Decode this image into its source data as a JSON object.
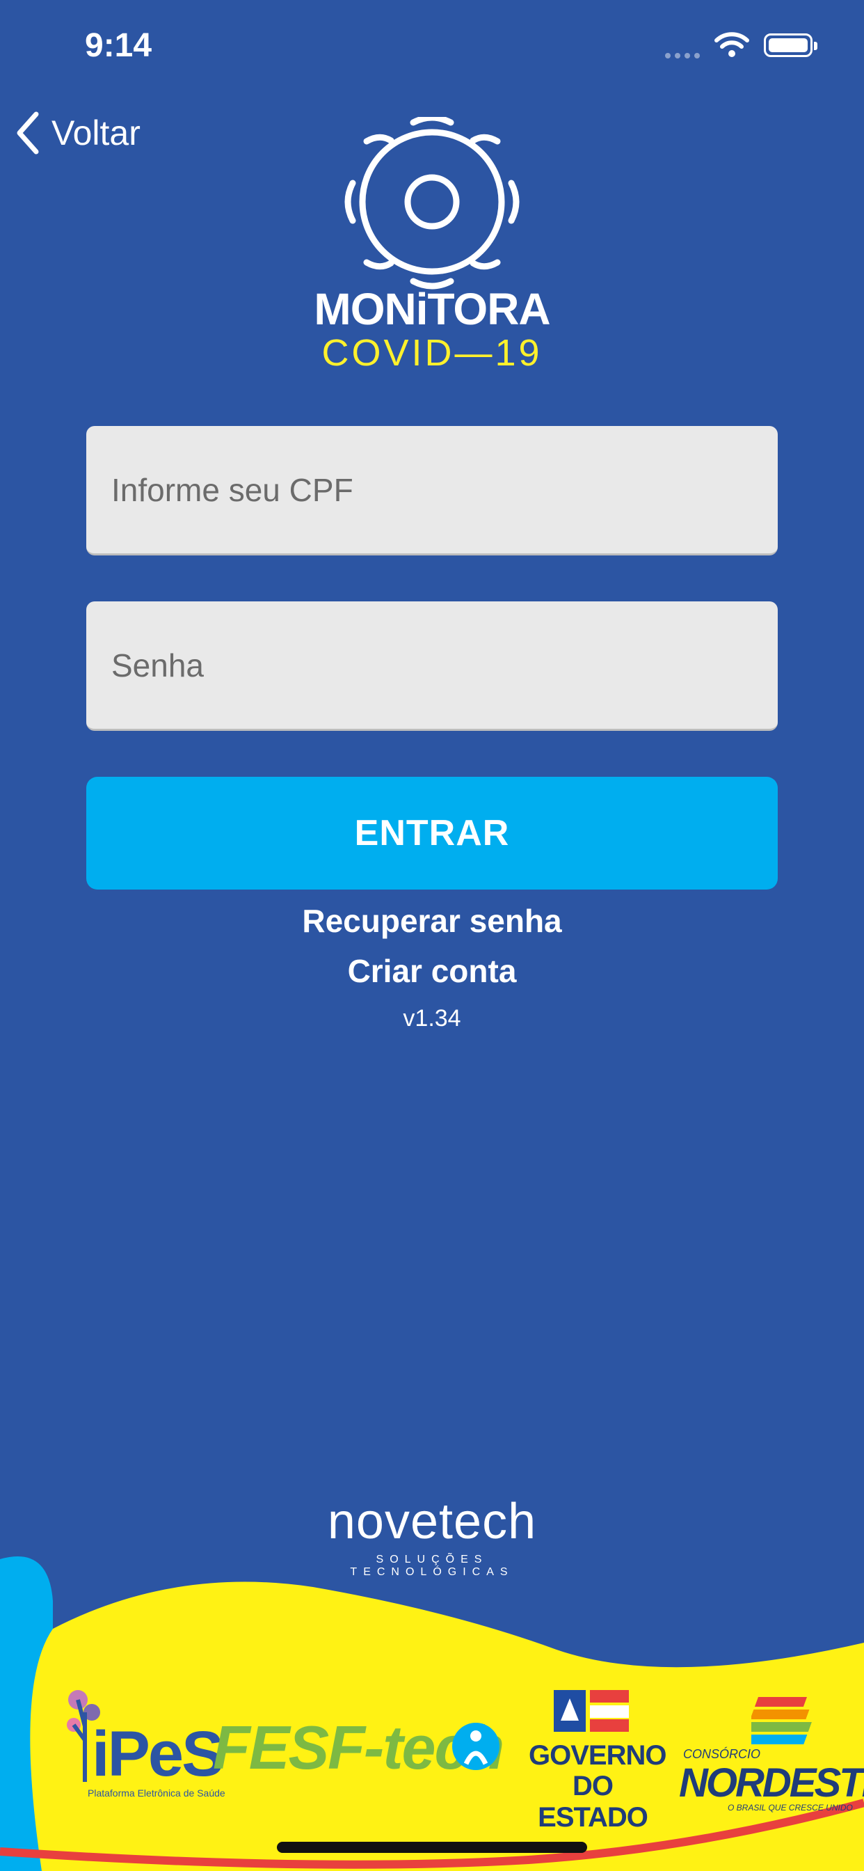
{
  "status": {
    "time": "9:14"
  },
  "nav": {
    "back_label": "Voltar"
  },
  "brand": {
    "title": "MONiTORA",
    "subtitle": "COVID—19"
  },
  "form": {
    "cpf_placeholder": "Informe seu CPF",
    "password_placeholder": "Senha",
    "submit_label": "ENTRAR"
  },
  "links": {
    "recover_password": "Recuperar senha",
    "create_account": "Criar conta"
  },
  "version": "v1.34",
  "footer": {
    "company": "novetech",
    "company_tagline": "SOLUÇÕES TECNOLÓGICAS",
    "partners": {
      "ipes": "iPeS",
      "ipes_tagline": "Plataforma Eletrônica de Saúde",
      "fesf": "FESF-tech",
      "governo_line1": "GOVERNO",
      "governo_line2": "DO ESTADO",
      "consorcio_small": "CONSÓRCIO",
      "consorcio": "NORDESTE",
      "consorcio_tagline": "O BRASIL QUE CRESCE UNIDO"
    }
  },
  "colors": {
    "background": "#2C55A3",
    "button": "#00AEEF",
    "accent_yellow": "#FFF12C",
    "field": "#E9E9E9"
  }
}
